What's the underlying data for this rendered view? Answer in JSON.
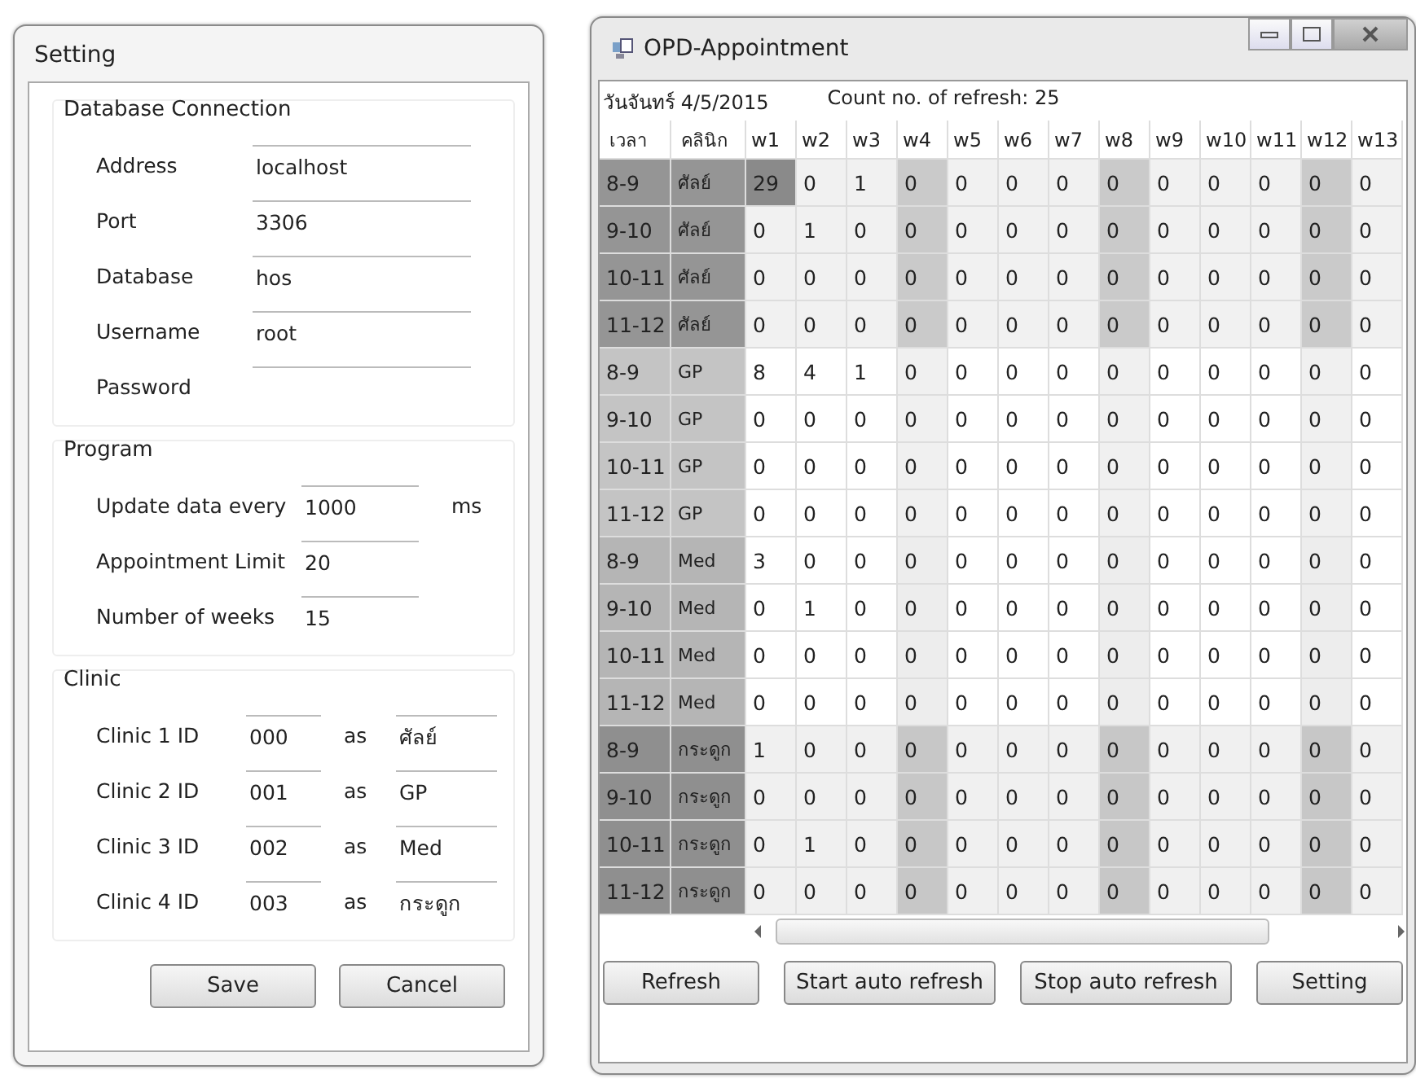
{
  "setting_window": {
    "title": "Setting",
    "database_connection": {
      "title": "Database Connection",
      "fields": [
        {
          "label": "Address",
          "value": "localhost"
        },
        {
          "label": "Port",
          "value": "3306"
        },
        {
          "label": "Database",
          "value": "hos"
        },
        {
          "label": "Username",
          "value": "root"
        },
        {
          "label": "Password"
        }
      ]
    },
    "program": {
      "title": "Program",
      "fields": [
        {
          "label": "Update data every",
          "value": "1000",
          "unit": "ms"
        },
        {
          "label": "Appointment Limit",
          "value": "20"
        },
        {
          "label": "Number of weeks",
          "value": "15"
        }
      ]
    },
    "clinic": {
      "title": "Clinic",
      "rows": [
        {
          "label": "Clinic 1 ID",
          "id": "000",
          "joiner": "as",
          "name": "ศัลย์"
        },
        {
          "label": "Clinic 2 ID",
          "id": "001",
          "joiner": "as",
          "name": "GP"
        },
        {
          "label": "Clinic 3 ID",
          "id": "002",
          "joiner": "as",
          "name": "Med"
        },
        {
          "label": "Clinic 4 ID",
          "id": "003",
          "joiner": "as",
          "name": "กระดูก"
        }
      ]
    },
    "buttons": [
      "Save",
      "Cancel"
    ]
  },
  "appointment_window": {
    "title": "OPD-Appointment",
    "date": "วันจันทร์ 4/5/2015",
    "refresh_count": "Count no. of refresh: 25",
    "columns": [
      "เวลา",
      "คลินิก",
      "w1",
      "w2",
      "w3",
      "w4",
      "w5",
      "w6",
      "w7",
      "w8",
      "w9",
      "w10",
      "w11",
      "w12",
      "w13"
    ],
    "rows": [
      {
        "time": "8-9",
        "clinic": "ศัลย์",
        "color": "#959595",
        "values": [
          "29",
          "0",
          "1",
          "0",
          "0",
          "0",
          "0",
          "0",
          "0",
          "0",
          "0",
          "0",
          "0"
        ]
      },
      {
        "time": "9-10",
        "clinic": "ศัลย์",
        "color": "#959595",
        "values": [
          "0",
          "1",
          "0",
          "0",
          "0",
          "0",
          "0",
          "0",
          "0",
          "0",
          "0",
          "0",
          "0"
        ]
      },
      {
        "time": "10-11",
        "clinic": "ศัลย์",
        "color": "#959595",
        "values": [
          "0",
          "0",
          "0",
          "0",
          "0",
          "0",
          "0",
          "0",
          "0",
          "0",
          "0",
          "0",
          "0"
        ]
      },
      {
        "time": "11-12",
        "clinic": "ศัลย์",
        "color": "#959595",
        "values": [
          "0",
          "0",
          "0",
          "0",
          "0",
          "0",
          "0",
          "0",
          "0",
          "0",
          "0",
          "0",
          "0"
        ]
      },
      {
        "time": "8-9",
        "clinic": "GP",
        "color": "#c4c4c4",
        "values": [
          "8",
          "4",
          "1",
          "0",
          "0",
          "0",
          "0",
          "0",
          "0",
          "0",
          "0",
          "0",
          "0"
        ]
      },
      {
        "time": "9-10",
        "clinic": "GP",
        "color": "#c4c4c4",
        "values": [
          "0",
          "0",
          "0",
          "0",
          "0",
          "0",
          "0",
          "0",
          "0",
          "0",
          "0",
          "0",
          "0"
        ]
      },
      {
        "time": "10-11",
        "clinic": "GP",
        "color": "#c4c4c4",
        "values": [
          "0",
          "0",
          "0",
          "0",
          "0",
          "0",
          "0",
          "0",
          "0",
          "0",
          "0",
          "0",
          "0"
        ]
      },
      {
        "time": "11-12",
        "clinic": "GP",
        "color": "#c4c4c4",
        "values": [
          "0",
          "0",
          "0",
          "0",
          "0",
          "0",
          "0",
          "0",
          "0",
          "0",
          "0",
          "0",
          "0"
        ]
      },
      {
        "time": "8-9",
        "clinic": "Med",
        "color": "#b5b5b5",
        "values": [
          "3",
          "0",
          "0",
          "0",
          "0",
          "0",
          "0",
          "0",
          "0",
          "0",
          "0",
          "0",
          "0"
        ]
      },
      {
        "time": "9-10",
        "clinic": "Med",
        "color": "#b5b5b5",
        "values": [
          "0",
          "1",
          "0",
          "0",
          "0",
          "0",
          "0",
          "0",
          "0",
          "0",
          "0",
          "0",
          "0"
        ]
      },
      {
        "time": "10-11",
        "clinic": "Med",
        "color": "#b5b5b5",
        "values": [
          "0",
          "0",
          "0",
          "0",
          "0",
          "0",
          "0",
          "0",
          "0",
          "0",
          "0",
          "0",
          "0"
        ]
      },
      {
        "time": "11-12",
        "clinic": "Med",
        "color": "#b5b5b5",
        "values": [
          "0",
          "0",
          "0",
          "0",
          "0",
          "0",
          "0",
          "0",
          "0",
          "0",
          "0",
          "0",
          "0"
        ]
      },
      {
        "time": "8-9",
        "clinic": "กระดูก",
        "color": "#8f8f8f",
        "values": [
          "1",
          "0",
          "0",
          "0",
          "0",
          "0",
          "0",
          "0",
          "0",
          "0",
          "0",
          "0",
          "0"
        ]
      },
      {
        "time": "9-10",
        "clinic": "กระดูก",
        "color": "#8f8f8f",
        "values": [
          "0",
          "0",
          "0",
          "0",
          "0",
          "0",
          "0",
          "0",
          "0",
          "0",
          "0",
          "0",
          "0"
        ]
      },
      {
        "time": "10-11",
        "clinic": "กระดูก",
        "color": "#8f8f8f",
        "values": [
          "0",
          "1",
          "0",
          "0",
          "0",
          "0",
          "0",
          "0",
          "0",
          "0",
          "0",
          "0",
          "0"
        ]
      },
      {
        "time": "11-12",
        "clinic": "กระดูก",
        "color": "#8f8f8f",
        "values": [
          "0",
          "0",
          "0",
          "0",
          "0",
          "0",
          "0",
          "0",
          "0",
          "0",
          "0",
          "0",
          "0"
        ]
      }
    ],
    "buttons": [
      "Refresh",
      "Start auto refresh",
      "Stop auto refresh",
      "Setting"
    ]
  }
}
